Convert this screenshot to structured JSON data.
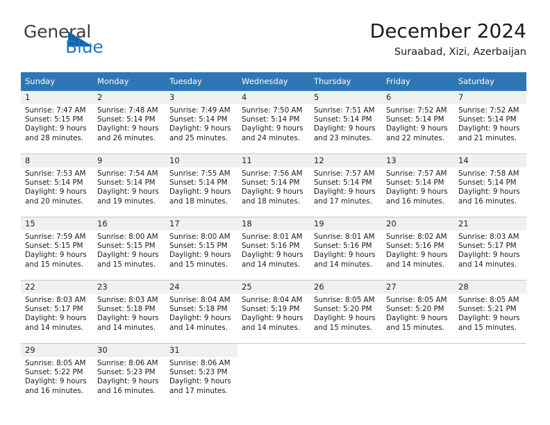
{
  "brand": {
    "name_part1": "General",
    "name_part2": "Blue",
    "triangle_color": "#1565ad",
    "blue_text_color": "#1f7ac4"
  },
  "header": {
    "title": "December 2024",
    "subtitle": "Suraabad, Xizi, Azerbaijan",
    "header_bar_color": "#2f76b5"
  },
  "weekdays": [
    "Sunday",
    "Monday",
    "Tuesday",
    "Wednesday",
    "Thursday",
    "Friday",
    "Saturday"
  ],
  "weeks": [
    [
      {
        "day": "1",
        "sunrise": "Sunrise: 7:47 AM",
        "sunset": "Sunset: 5:15 PM",
        "daylight1": "Daylight: 9 hours",
        "daylight2": "and 28 minutes."
      },
      {
        "day": "2",
        "sunrise": "Sunrise: 7:48 AM",
        "sunset": "Sunset: 5:14 PM",
        "daylight1": "Daylight: 9 hours",
        "daylight2": "and 26 minutes."
      },
      {
        "day": "3",
        "sunrise": "Sunrise: 7:49 AM",
        "sunset": "Sunset: 5:14 PM",
        "daylight1": "Daylight: 9 hours",
        "daylight2": "and 25 minutes."
      },
      {
        "day": "4",
        "sunrise": "Sunrise: 7:50 AM",
        "sunset": "Sunset: 5:14 PM",
        "daylight1": "Daylight: 9 hours",
        "daylight2": "and 24 minutes."
      },
      {
        "day": "5",
        "sunrise": "Sunrise: 7:51 AM",
        "sunset": "Sunset: 5:14 PM",
        "daylight1": "Daylight: 9 hours",
        "daylight2": "and 23 minutes."
      },
      {
        "day": "6",
        "sunrise": "Sunrise: 7:52 AM",
        "sunset": "Sunset: 5:14 PM",
        "daylight1": "Daylight: 9 hours",
        "daylight2": "and 22 minutes."
      },
      {
        "day": "7",
        "sunrise": "Sunrise: 7:52 AM",
        "sunset": "Sunset: 5:14 PM",
        "daylight1": "Daylight: 9 hours",
        "daylight2": "and 21 minutes."
      }
    ],
    [
      {
        "day": "8",
        "sunrise": "Sunrise: 7:53 AM",
        "sunset": "Sunset: 5:14 PM",
        "daylight1": "Daylight: 9 hours",
        "daylight2": "and 20 minutes."
      },
      {
        "day": "9",
        "sunrise": "Sunrise: 7:54 AM",
        "sunset": "Sunset: 5:14 PM",
        "daylight1": "Daylight: 9 hours",
        "daylight2": "and 19 minutes."
      },
      {
        "day": "10",
        "sunrise": "Sunrise: 7:55 AM",
        "sunset": "Sunset: 5:14 PM",
        "daylight1": "Daylight: 9 hours",
        "daylight2": "and 18 minutes."
      },
      {
        "day": "11",
        "sunrise": "Sunrise: 7:56 AM",
        "sunset": "Sunset: 5:14 PM",
        "daylight1": "Daylight: 9 hours",
        "daylight2": "and 18 minutes."
      },
      {
        "day": "12",
        "sunrise": "Sunrise: 7:57 AM",
        "sunset": "Sunset: 5:14 PM",
        "daylight1": "Daylight: 9 hours",
        "daylight2": "and 17 minutes."
      },
      {
        "day": "13",
        "sunrise": "Sunrise: 7:57 AM",
        "sunset": "Sunset: 5:14 PM",
        "daylight1": "Daylight: 9 hours",
        "daylight2": "and 16 minutes."
      },
      {
        "day": "14",
        "sunrise": "Sunrise: 7:58 AM",
        "sunset": "Sunset: 5:14 PM",
        "daylight1": "Daylight: 9 hours",
        "daylight2": "and 16 minutes."
      }
    ],
    [
      {
        "day": "15",
        "sunrise": "Sunrise: 7:59 AM",
        "sunset": "Sunset: 5:15 PM",
        "daylight1": "Daylight: 9 hours",
        "daylight2": "and 15 minutes."
      },
      {
        "day": "16",
        "sunrise": "Sunrise: 8:00 AM",
        "sunset": "Sunset: 5:15 PM",
        "daylight1": "Daylight: 9 hours",
        "daylight2": "and 15 minutes."
      },
      {
        "day": "17",
        "sunrise": "Sunrise: 8:00 AM",
        "sunset": "Sunset: 5:15 PM",
        "daylight1": "Daylight: 9 hours",
        "daylight2": "and 15 minutes."
      },
      {
        "day": "18",
        "sunrise": "Sunrise: 8:01 AM",
        "sunset": "Sunset: 5:16 PM",
        "daylight1": "Daylight: 9 hours",
        "daylight2": "and 14 minutes."
      },
      {
        "day": "19",
        "sunrise": "Sunrise: 8:01 AM",
        "sunset": "Sunset: 5:16 PM",
        "daylight1": "Daylight: 9 hours",
        "daylight2": "and 14 minutes."
      },
      {
        "day": "20",
        "sunrise": "Sunrise: 8:02 AM",
        "sunset": "Sunset: 5:16 PM",
        "daylight1": "Daylight: 9 hours",
        "daylight2": "and 14 minutes."
      },
      {
        "day": "21",
        "sunrise": "Sunrise: 8:03 AM",
        "sunset": "Sunset: 5:17 PM",
        "daylight1": "Daylight: 9 hours",
        "daylight2": "and 14 minutes."
      }
    ],
    [
      {
        "day": "22",
        "sunrise": "Sunrise: 8:03 AM",
        "sunset": "Sunset: 5:17 PM",
        "daylight1": "Daylight: 9 hours",
        "daylight2": "and 14 minutes."
      },
      {
        "day": "23",
        "sunrise": "Sunrise: 8:03 AM",
        "sunset": "Sunset: 5:18 PM",
        "daylight1": "Daylight: 9 hours",
        "daylight2": "and 14 minutes."
      },
      {
        "day": "24",
        "sunrise": "Sunrise: 8:04 AM",
        "sunset": "Sunset: 5:18 PM",
        "daylight1": "Daylight: 9 hours",
        "daylight2": "and 14 minutes."
      },
      {
        "day": "25",
        "sunrise": "Sunrise: 8:04 AM",
        "sunset": "Sunset: 5:19 PM",
        "daylight1": "Daylight: 9 hours",
        "daylight2": "and 14 minutes."
      },
      {
        "day": "26",
        "sunrise": "Sunrise: 8:05 AM",
        "sunset": "Sunset: 5:20 PM",
        "daylight1": "Daylight: 9 hours",
        "daylight2": "and 15 minutes."
      },
      {
        "day": "27",
        "sunrise": "Sunrise: 8:05 AM",
        "sunset": "Sunset: 5:20 PM",
        "daylight1": "Daylight: 9 hours",
        "daylight2": "and 15 minutes."
      },
      {
        "day": "28",
        "sunrise": "Sunrise: 8:05 AM",
        "sunset": "Sunset: 5:21 PM",
        "daylight1": "Daylight: 9 hours",
        "daylight2": "and 15 minutes."
      }
    ],
    [
      {
        "day": "29",
        "sunrise": "Sunrise: 8:05 AM",
        "sunset": "Sunset: 5:22 PM",
        "daylight1": "Daylight: 9 hours",
        "daylight2": "and 16 minutes."
      },
      {
        "day": "30",
        "sunrise": "Sunrise: 8:06 AM",
        "sunset": "Sunset: 5:23 PM",
        "daylight1": "Daylight: 9 hours",
        "daylight2": "and 16 minutes."
      },
      {
        "day": "31",
        "sunrise": "Sunrise: 8:06 AM",
        "sunset": "Sunset: 5:23 PM",
        "daylight1": "Daylight: 9 hours",
        "daylight2": "and 17 minutes."
      },
      {
        "day": "",
        "sunrise": "",
        "sunset": "",
        "daylight1": "",
        "daylight2": ""
      },
      {
        "day": "",
        "sunrise": "",
        "sunset": "",
        "daylight1": "",
        "daylight2": ""
      },
      {
        "day": "",
        "sunrise": "",
        "sunset": "",
        "daylight1": "",
        "daylight2": ""
      },
      {
        "day": "",
        "sunrise": "",
        "sunset": "",
        "daylight1": "",
        "daylight2": ""
      }
    ]
  ]
}
